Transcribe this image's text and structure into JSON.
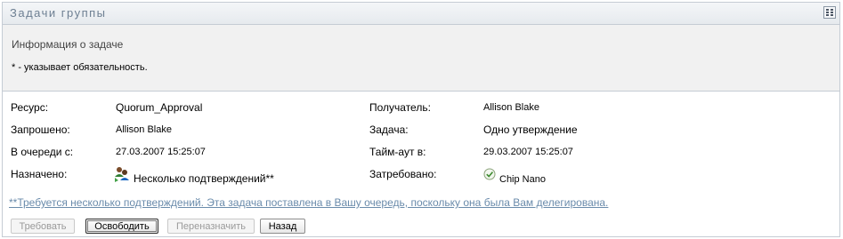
{
  "panel": {
    "title": "Задачи группы",
    "menu_icon": "grid-menu-icon"
  },
  "info": {
    "title": "Информация о задаче",
    "required_note": "* - указывает обязательность."
  },
  "fields": {
    "resource_label": "Ресурс:",
    "resource_value": "Quorum_Approval",
    "recipient_label": "Получатель:",
    "recipient_value": "Allison Blake",
    "requested_label": "Запрошено:",
    "requested_value": "Allison Blake",
    "task_label": "Задача:",
    "task_value": "Одно утверждение",
    "queued_label": "В очереди с:",
    "queued_value": "27.03.2007 15:25:07",
    "timeout_label": "Тайм-аут в:",
    "timeout_value": "29.03.2007 15:25:07",
    "assigned_label": "Назначено:",
    "assigned_value": "Несколько подтверждений**",
    "assigned_icon": "multiple-users-icon",
    "claimed_label": "Затребовано:",
    "claimed_value": "Chip Nano",
    "claimed_icon": "check-circle-icon"
  },
  "note_link": "**Требуется несколько подтверждений. Эта задача поставлена в Вашу очередь, поскольку она была Вам делегирована.",
  "buttons": {
    "claim": "Требовать",
    "release": "Освободить",
    "reassign": "Переназначить",
    "back": "Назад"
  }
}
